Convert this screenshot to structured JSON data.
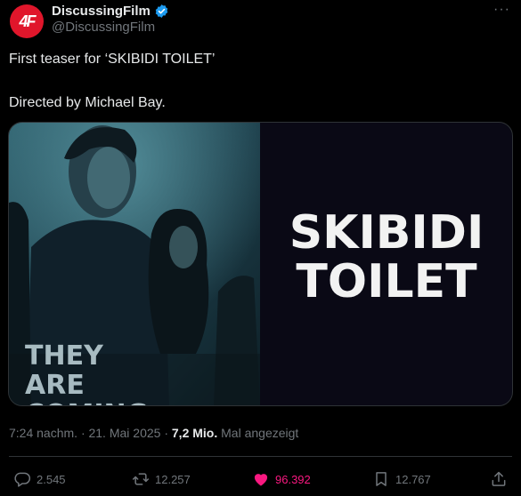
{
  "author": {
    "avatar_text": "4F",
    "display_name": "DiscussingFilm",
    "handle": "@DiscussingFilm",
    "verified_icon": "verified-badge-icon",
    "avatar_color": "#e0162b"
  },
  "more_label": "···",
  "post": {
    "line1": "First teaser for ‘SKIBIDI TOILET’",
    "line2": "Directed by Michael Bay."
  },
  "media": {
    "title_line1": "SKIBIDI",
    "title_line2": "TOILET",
    "tagline_line1": "THEY",
    "tagline_line2": "ARE",
    "tagline_line3": "COMING"
  },
  "meta": {
    "time": "7:24 nachm. · 21. Mai 2025 ·",
    "views_count": "7,2 Mio.",
    "views_label": "Mal angezeigt"
  },
  "actions": {
    "replies": "2.545",
    "reposts": "12.257",
    "likes": "96.392",
    "bookmarks": "12.767"
  },
  "colors": {
    "like": "#f91880",
    "muted": "#71767b",
    "verified": "#1d9bf0"
  }
}
